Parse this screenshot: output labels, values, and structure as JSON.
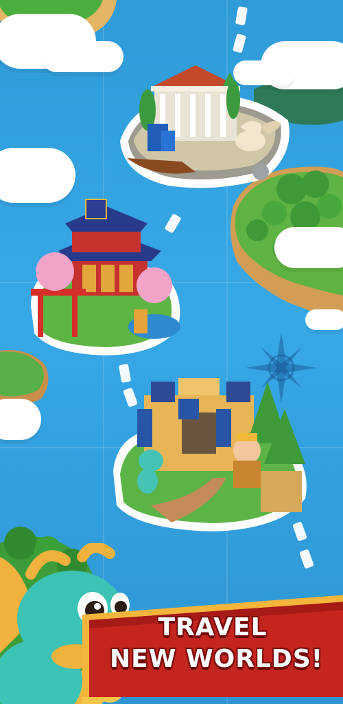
{
  "promo": {
    "headline_line1": "TRAVEL",
    "headline_line2": "NEW WORLDS!"
  },
  "worlds": [
    {
      "name": "greek-temple-world"
    },
    {
      "name": "japanese-shrine-world"
    },
    {
      "name": "medieval-castle-world"
    }
  ],
  "colors": {
    "sea": "#37a8e6",
    "banner_red": "#c5251f",
    "banner_gold": "#f3b53b",
    "land_green": "#5cb84a",
    "dragon_teal": "#3cc3b5"
  }
}
